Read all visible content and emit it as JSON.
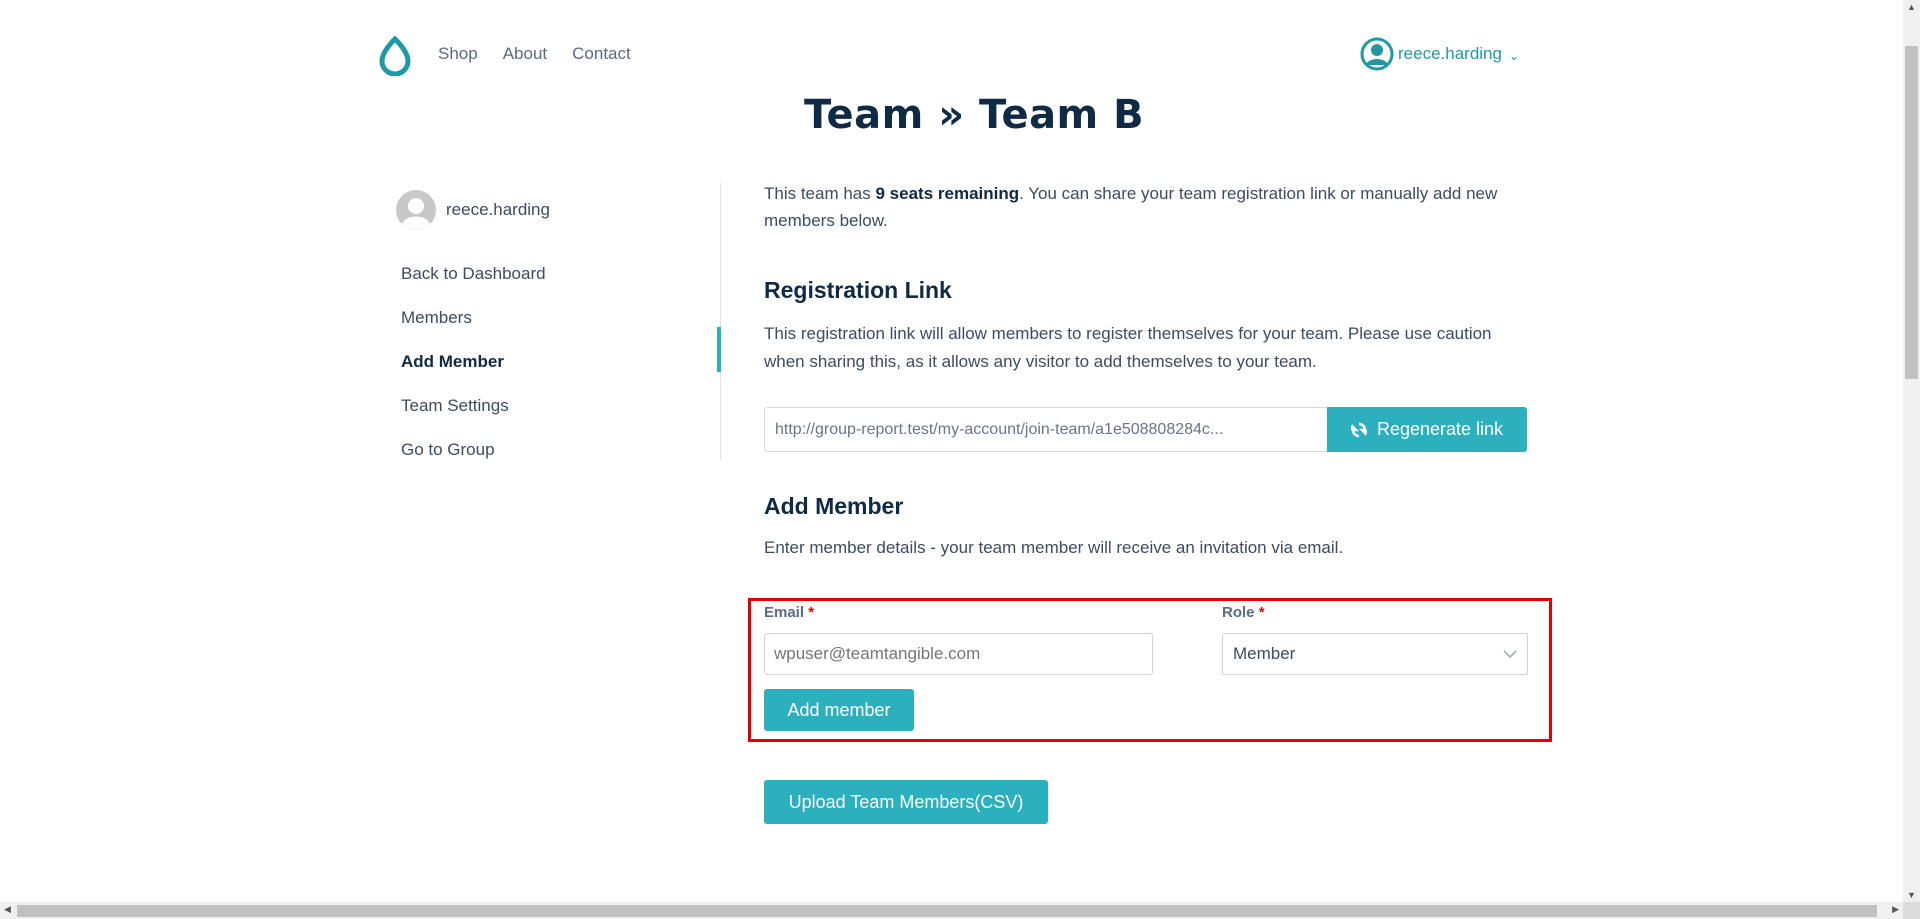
{
  "header": {
    "nav": [
      "Shop",
      "About",
      "Contact"
    ],
    "user": "reece.harding"
  },
  "page_title": "Team » Team B",
  "sidebar": {
    "user": "reece.harding",
    "items": [
      {
        "label": "Back to Dashboard",
        "active": false
      },
      {
        "label": "Members",
        "active": false
      },
      {
        "label": "Add Member",
        "active": true
      },
      {
        "label": "Team Settings",
        "active": false
      },
      {
        "label": "Go to Group",
        "active": false
      }
    ]
  },
  "main": {
    "intro_prefix": "This team has ",
    "intro_bold": "9 seats remaining",
    "intro_suffix": ". You can share your team registration link or manually add new members below.",
    "registration": {
      "heading": "Registration Link",
      "description": "This registration link will allow members to register themselves for your team. Please use caution when sharing this, as it allows any visitor to add themselves to your team.",
      "link_value": "http://group-report.test/my-account/join-team/a1e508808284c...",
      "regenerate_label": "Regenerate link"
    },
    "add_member": {
      "heading": "Add Member",
      "description": "Enter member details - your team member will receive an invitation via email.",
      "email_label": "Email",
      "email_placeholder": "wpuser@teamtangible.com",
      "role_label": "Role",
      "role_value": "Member",
      "required_mark": "*",
      "submit_label": "Add member"
    },
    "upload_label": "Upload Team Members(CSV)"
  },
  "colors": {
    "accent": "#2cb0bd",
    "brand": "#1f9aa5",
    "heading": "#0e2a45",
    "highlight": "#e30000"
  }
}
